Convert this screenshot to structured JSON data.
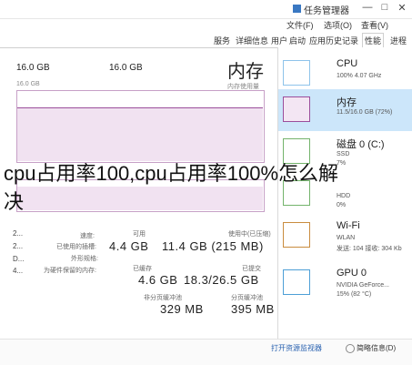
{
  "window": {
    "title": "任务管理器",
    "minimize": "—",
    "maximize": "□",
    "close": "✕"
  },
  "menu": [
    "文件(F)",
    "选项(O)",
    "查看(V)"
  ],
  "tabs": [
    "进程",
    "性能",
    "应用历史记录",
    "启动",
    "用户",
    "详细信息",
    "服务"
  ],
  "active_tab": "性能",
  "main": {
    "title": "内存",
    "subtitle": "内存使用量",
    "left_total": "16.0 GB",
    "left_sub": "16.0 GB",
    "right_total": "16.0 GB"
  },
  "stats": {
    "in_use_label": "使用中(已压缩)",
    "in_use_value": "11.4 GB (215 MB)",
    "available_label": "可用",
    "available_value": "4.4 GB",
    "committed_label": "已提交",
    "committed_value": "18.3/26.5 GB",
    "cached_label": "已缓存",
    "cached_value": "4.6 GB",
    "paged_label": "分页缓冲池",
    "paged_value": "395 MB",
    "nonpaged_label": "非分页缓冲池",
    "nonpaged_value": "329 MB",
    "speed_label": "速度:",
    "slots_label": "已使用的插槽:",
    "form_label": "外形规格:",
    "reserved_label": "为硬件保留的内存:"
  },
  "sidebar": [
    {
      "name": "CPU",
      "detail": "100% 4.07 GHz",
      "detail2": ""
    },
    {
      "name": "内存",
      "detail": "11.5/16.0 GB (72%)",
      "detail2": ""
    },
    {
      "name": "磁盘 0 (C:)",
      "detail": "SSD",
      "detail2": "7%"
    },
    {
      "name": "",
      "detail": "HDD",
      "detail2": "0%"
    },
    {
      "name": "Wi-Fi",
      "detail": "WLAN",
      "detail2": "发送: 104 接收: 304 Kb"
    },
    {
      "name": "GPU 0",
      "detail": "NVIDIA GeForce...",
      "detail2": "15% (82 °C)"
    }
  ],
  "edge_labels": [
    "2...",
    "2...",
    "D...",
    "4..."
  ],
  "overlay": {
    "line1": "cpu占用率100,cpu占用率100%怎么解",
    "line2": "决"
  },
  "footer": {
    "fewer_details": "简略信息(D)",
    "open_monitor": "打开资源监视器"
  }
}
